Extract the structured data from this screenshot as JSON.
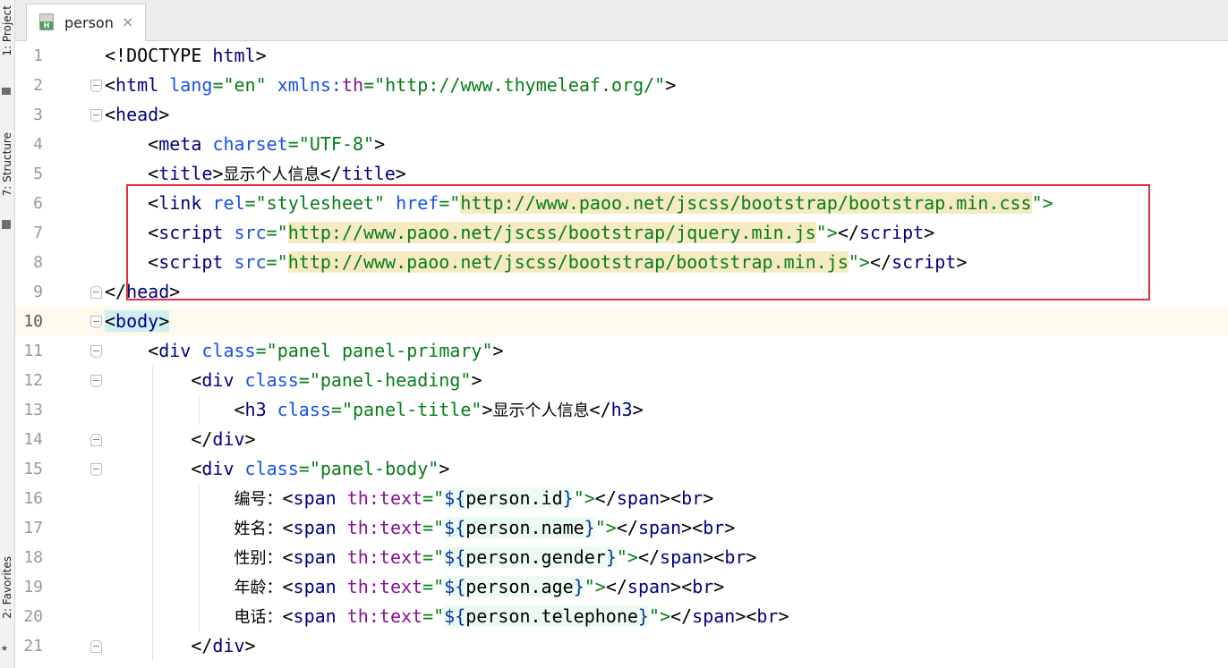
{
  "toolstrip": {
    "project_label": "1: Project",
    "structure_label": "7: Structure",
    "favorites_label": "2: Favorites"
  },
  "tab": {
    "name": "person",
    "close": "×",
    "file_icon_letter": "H"
  },
  "lines": {
    "l1": {
      "num": "1",
      "p": [
        "<!DOCTYPE ",
        "html",
        ">"
      ]
    },
    "l2": {
      "num": "2",
      "p": [
        "<",
        "html ",
        "lang",
        "=",
        "\"en\"",
        " ",
        "xmlns",
        ":",
        "th",
        "=",
        "\"http://www.thymeleaf.org/\"",
        ">"
      ]
    },
    "l3": {
      "num": "3",
      "p": [
        "<",
        "head",
        ">"
      ]
    },
    "l4": {
      "num": "4",
      "p": [
        "    <",
        "meta ",
        "charset",
        "=",
        "\"UTF-8\"",
        ">"
      ]
    },
    "l5": {
      "num": "5",
      "p": [
        "    <",
        "title",
        ">",
        "显示个人信息",
        "</",
        "title",
        ">"
      ]
    },
    "l6": {
      "num": "6",
      "p": [
        "    <",
        "link ",
        "rel",
        "=",
        "\"stylesheet\"",
        " ",
        "href",
        "=\"",
        "http://www.paoo.net/jscss/bootstrap/bootstrap.min.css",
        "\">"
      ]
    },
    "l7": {
      "num": "7",
      "p": [
        "    <",
        "script ",
        "src",
        "=\"",
        "http://www.paoo.net/jscss/bootstrap/jquery.min.js",
        "\">",
        "</",
        "script",
        ">"
      ]
    },
    "l8": {
      "num": "8",
      "p": [
        "    <",
        "script ",
        "src",
        "=\"",
        "http://www.paoo.net/jscss/bootstrap/bootstrap.min.js",
        "\">",
        "</",
        "script",
        ">"
      ]
    },
    "l9": {
      "num": "9",
      "p": [
        "</",
        "head",
        ">"
      ]
    },
    "l10": {
      "num": "10",
      "p": [
        "<",
        "body",
        ">"
      ]
    },
    "l11": {
      "num": "11",
      "p": [
        "    <",
        "div ",
        "class",
        "=",
        "\"panel panel-primary\"",
        ">"
      ]
    },
    "l12": {
      "num": "12",
      "p": [
        "        <",
        "div ",
        "class",
        "=",
        "\"panel-heading\"",
        ">"
      ]
    },
    "l13": {
      "num": "13",
      "p": [
        "            <",
        "h3 ",
        "class",
        "=",
        "\"panel-title\"",
        ">",
        "显示个人信息",
        "</",
        "h3",
        ">"
      ]
    },
    "l14": {
      "num": "14",
      "p": [
        "        </",
        "div",
        ">"
      ]
    },
    "l15": {
      "num": "15",
      "p": [
        "        <",
        "div ",
        "class",
        "=",
        "\"panel-body\"",
        ">"
      ]
    },
    "l16": {
      "num": "16",
      "p": [
        "            ",
        "编号：",
        "<",
        "span ",
        "th",
        ":",
        "text",
        "=\"",
        "${",
        "person.id",
        "}",
        "\">",
        "</",
        "span",
        "><",
        "br",
        ">"
      ]
    },
    "l17": {
      "num": "17",
      "p": [
        "            ",
        "姓名：",
        "<",
        "span ",
        "th",
        ":",
        "text",
        "=\"",
        "${",
        "person.name",
        "}",
        "\">",
        "</",
        "span",
        "><",
        "br",
        ">"
      ]
    },
    "l18": {
      "num": "18",
      "p": [
        "            ",
        "性别：",
        "<",
        "span ",
        "th",
        ":",
        "text",
        "=\"",
        "${",
        "person.gender",
        "}",
        "\">",
        "</",
        "span",
        "><",
        "br",
        ">"
      ]
    },
    "l19": {
      "num": "19",
      "p": [
        "            ",
        "年龄：",
        "<",
        "span ",
        "th",
        ":",
        "text",
        "=\"",
        "${",
        "person.age",
        "}",
        "\">",
        "</",
        "span",
        "><",
        "br",
        ">"
      ]
    },
    "l20": {
      "num": "20",
      "p": [
        "            ",
        "电话：",
        "<",
        "span ",
        "th",
        ":",
        "text",
        "=\"",
        "${",
        "person.telephone",
        "}",
        "\">",
        "</",
        "span",
        "><",
        "br",
        ">"
      ]
    },
    "l21": {
      "num": "21",
      "p": [
        "        </",
        "div",
        ">"
      ]
    }
  },
  "colors": {
    "tag": "#000080",
    "attribute": "#1750eb",
    "string": "#067d17",
    "namespace": "#871094",
    "url_highlight": "#f5eac2",
    "current_line": "#fcfaed",
    "annotation_box": "#e0323a"
  }
}
